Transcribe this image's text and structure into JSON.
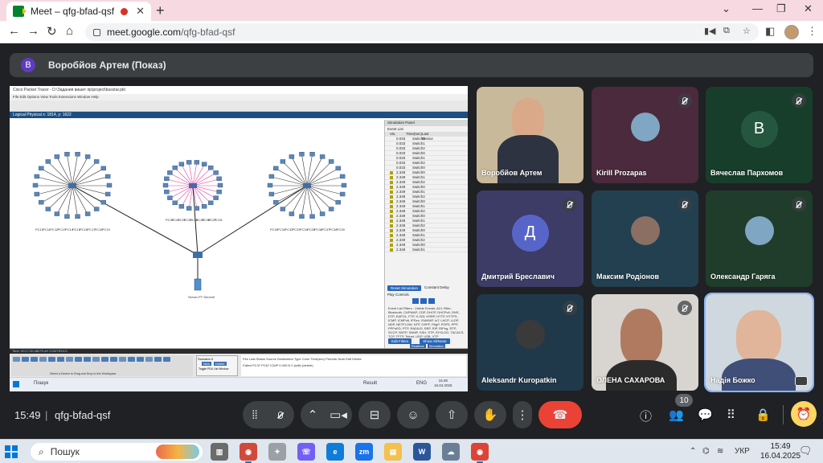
{
  "browser": {
    "tab_title": "Meet – qfg-bfad-qsf",
    "tab_close": "✕",
    "new_tab": "+",
    "url_host": "meet.google.com",
    "url_path": "/qfg-bfad-qsf",
    "minimize": "⌄",
    "restore": "—",
    "maximize": "❐",
    "close": "✕"
  },
  "presenter": {
    "avatar_letter": "В",
    "label": "Воробйов Артем (Показ)"
  },
  "shared_screen": {
    "window_title": "Cisco Packet Tracer - D:\\Задания вишет пр\\project\\busstar.pkt",
    "menu": "File   Edit   Options   View   Tools   Extensions   Window   Help",
    "view_tabs": "Logical    Physical   x: 1814, y: 1622",
    "sim_panel_title": "Simulation Panel",
    "event_list_label": "Event List",
    "event_header": [
      "Vis.",
      "Time(sec)",
      "Last Device"
    ],
    "events": [
      [
        "0.033",
        "Switch0"
      ],
      [
        "0.033",
        "Switch1"
      ],
      [
        "0.033",
        "Switch2"
      ],
      [
        "0.033",
        "Switch0"
      ],
      [
        "0.033",
        "Switch1"
      ],
      [
        "0.033",
        "Switch2"
      ],
      [
        "0.033",
        "Switch0"
      ],
      [
        "2.349",
        "Switch0"
      ],
      [
        "2.349",
        "Switch1"
      ],
      [
        "2.349",
        "Switch2"
      ],
      [
        "2.349",
        "Switch0"
      ],
      [
        "2.349",
        "Switch1"
      ],
      [
        "2.349",
        "Switch2"
      ],
      [
        "2.349",
        "Switch0"
      ],
      [
        "2.349",
        "Switch1"
      ],
      [
        "2.349",
        "Switch2"
      ],
      [
        "2.349",
        "Switch0"
      ],
      [
        "2.349",
        "Switch1"
      ],
      [
        "2.349",
        "Switch2"
      ],
      [
        "2.349",
        "Switch0"
      ],
      [
        "2.349",
        "Switch1"
      ],
      [
        "2.349",
        "Switch2"
      ],
      [
        "2.349",
        "Switch0"
      ],
      [
        "2.349",
        "Switch1"
      ]
    ],
    "reset_sim": "Reset Simulation",
    "constant_delay": "Constant Delay",
    "captured": "Captured to: 2.349 s",
    "play_controls": "Play Controls",
    "filters_text": "Event List Filters - Visible Events: ACL Filter, Bluetooth, CAPWAP, CDP, DHCP, DHCPv6, DNS, DTP, EAPOL, FTP, H.323, HSRP, HTTP, HTTPS, ICMP, ICMPv6, IPSec, ISAKMP, IoT, LACP, LLDP, NDP, NETFLOW, NTP, OSPF, PAgP, POP3, PPP, PPPoED, PTP, RADIUS, REP, RIP, RIPng, RTP, SCCP, SMTP, SNMP, SSH, STP, SYSLOG, TACACS, TCP, TFTP, Telnet, UDP, USB, VTP",
    "edit_filters": "Edit Filters",
    "show_all": "Show All/None",
    "realtime": "Realtime",
    "simulation": "Simulation",
    "time_label": "Time: 00:17:20.480  PLAY CONTROLS",
    "scenario": "Scenario 0",
    "new_btn": "New",
    "delete_btn": "Delete",
    "toggle_pdu": "Toggle PDU List Window",
    "pdu_headers": "Fire   Last Status   Source   Destination   Type   Color   Time(sec)   Periodic   Num   Edit   Delete",
    "pdu_row": "Failed   PC37   PC67   ICMP   0.000   N   0   (edit)   (delete)",
    "device_hint": "Select a Device to Drag and Drop to the Workspace",
    "server_label": "Server-PT Server0",
    "win_search": "Пошук",
    "win_result": "Result",
    "win_lang": "ENG",
    "win_time": "15:49",
    "win_date": "16.04.2025",
    "pc_labels_left": [
      "PC10",
      "PC11",
      "PC12",
      "PC13",
      "PC14",
      "PC15",
      "PC16",
      "PC17",
      "PC18",
      "PC19"
    ],
    "pc_labels_mid": [
      "PC20",
      "PC21",
      "PC22",
      "PC23",
      "PC24",
      "PC25",
      "PC26",
      "PC27",
      "PC28"
    ],
    "pc_labels_right": [
      "PC30",
      "PC31",
      "PC32",
      "PC33",
      "PC34",
      "PC35",
      "PC36",
      "PC37",
      "PC38",
      "PC39"
    ]
  },
  "participants": [
    {
      "name": "Воробйов Артем",
      "type": "video",
      "muted": false
    },
    {
      "name": "Kirill Prozapas",
      "type": "photo",
      "muted": true
    },
    {
      "name": "Вячеслав Пархомов",
      "type": "letter",
      "letter": "В",
      "muted": true
    },
    {
      "name": "Дмитрий Бреславич",
      "type": "letter",
      "letter": "Д",
      "muted": true
    },
    {
      "name": "Максим Родіонов",
      "type": "photo",
      "muted": true
    },
    {
      "name": "Олександр Гаряга",
      "type": "photo",
      "muted": true
    },
    {
      "name": "Aleksandr Kuropatkin",
      "type": "photo",
      "muted": true
    },
    {
      "name": "ОЛЕНА САХАРОВА",
      "type": "video",
      "muted": true
    },
    {
      "name": "Надія Божко",
      "type": "video",
      "muted": false
    }
  ],
  "meeting": {
    "time": "15:49",
    "code": "qfg-bfad-qsf",
    "participant_count": "10"
  },
  "taskbar": {
    "search_placeholder": "Пошук",
    "lang": "УКР",
    "time": "15:49",
    "date": "16.04.2025"
  },
  "colors": {
    "meet_bg": "#202124",
    "end_call": "#ea4335",
    "tab_strip": "#f7d9e1",
    "timer": "#fdd663"
  }
}
